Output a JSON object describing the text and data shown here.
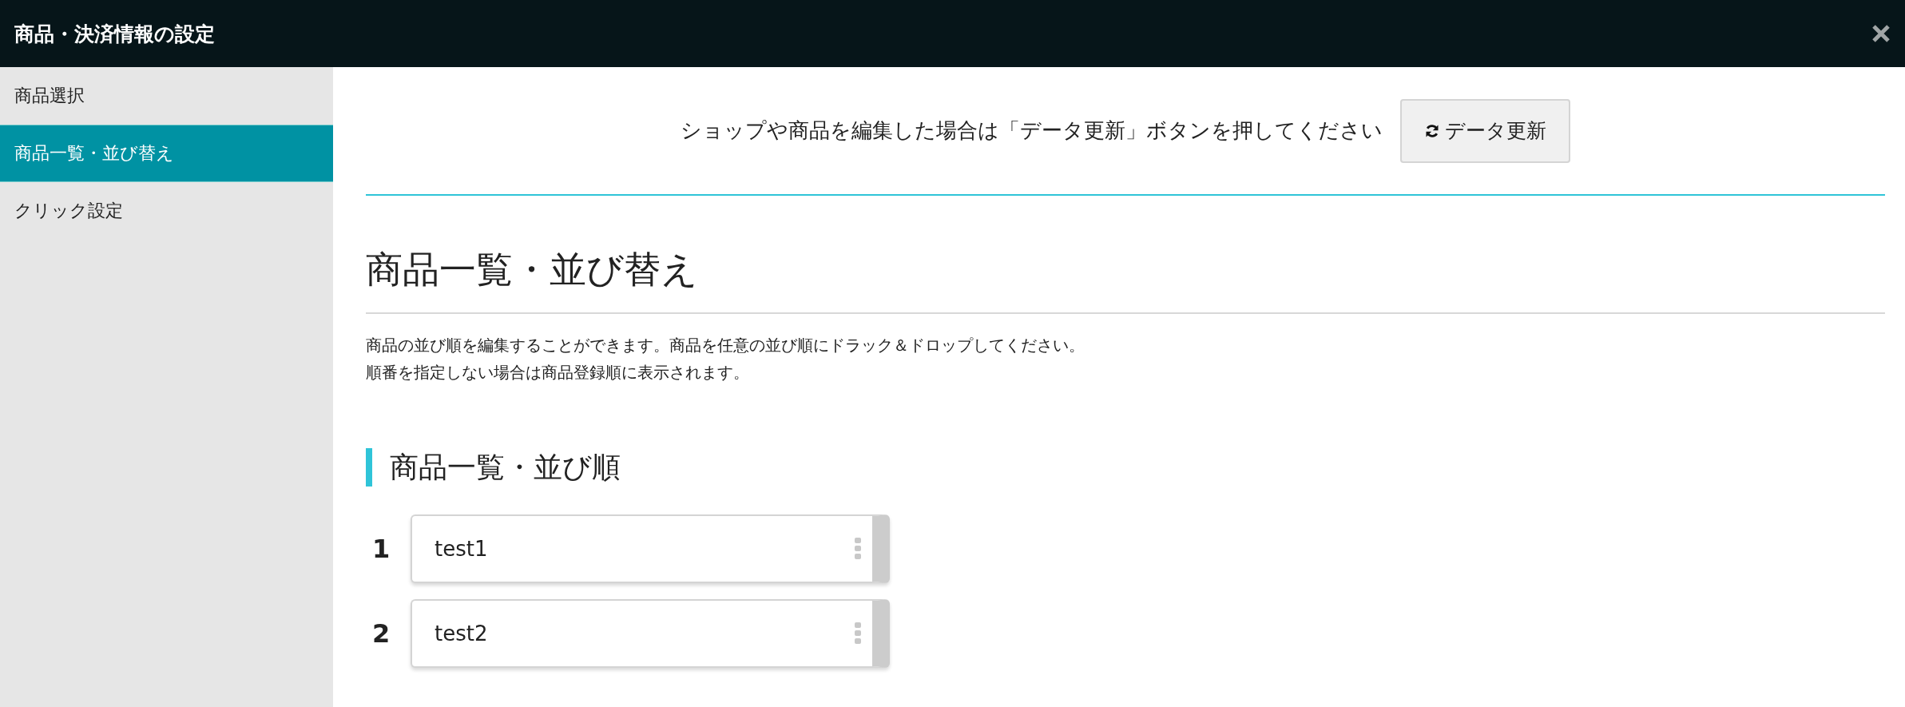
{
  "window": {
    "title": "商品・決済情報の設定"
  },
  "sidebar": {
    "items": [
      {
        "label": "商品選択",
        "selected": false
      },
      {
        "label": "商品一覧・並び替え",
        "selected": true
      },
      {
        "label": "クリック設定",
        "selected": false
      }
    ]
  },
  "notice": {
    "text": "ショップや商品を編集した場合は「データ更新」ボタンを押してください",
    "button": "データ更新"
  },
  "page": {
    "heading": "商品一覧・並び替え",
    "description": [
      "商品の並び順を編集することができます。商品を任意の並び順にドラック＆ドロップしてください。",
      "順番を指定しない場合は商品登録順に表示されます。"
    ]
  },
  "sort_list": {
    "heading": "商品一覧・並び順",
    "items": [
      {
        "number": "1",
        "name": "test1"
      },
      {
        "number": "2",
        "name": "test2"
      }
    ]
  }
}
